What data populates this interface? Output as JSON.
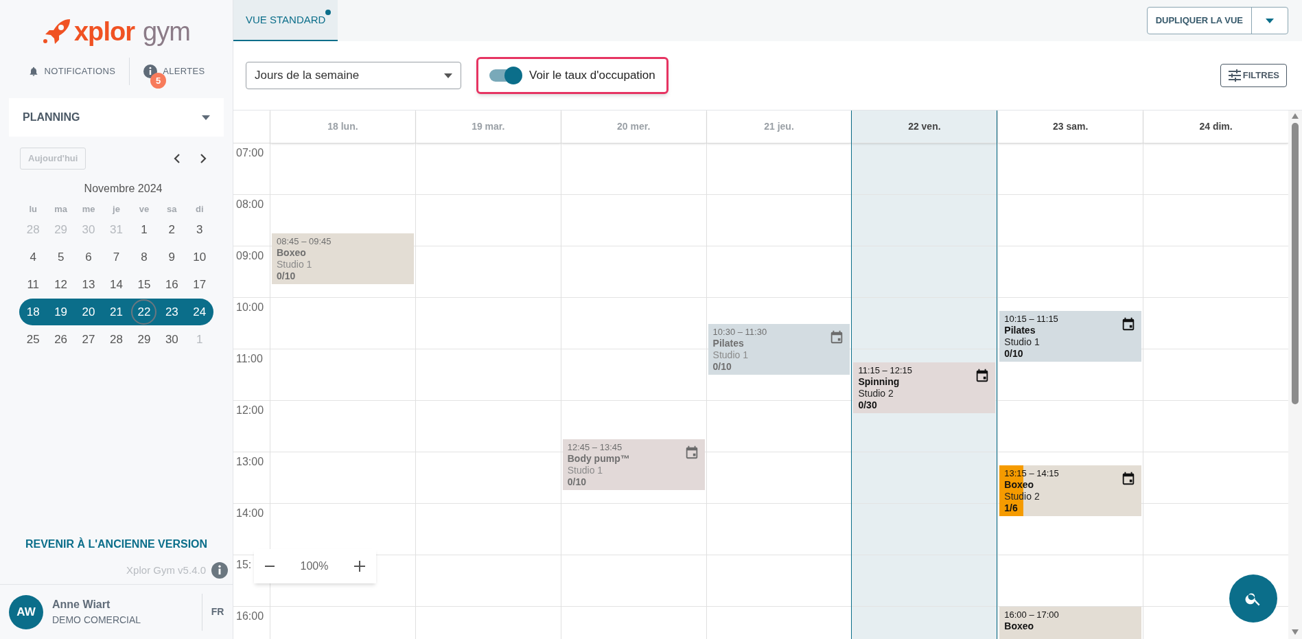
{
  "logo": {
    "brand": "xplor",
    "product": "gym"
  },
  "header_links": [
    {
      "kind": "notifications",
      "label": "NOTIFICATIONS"
    },
    {
      "kind": "alerts",
      "label": "ALERTES",
      "badge": "5"
    }
  ],
  "section_select": {
    "value": "PLANNING"
  },
  "mini_calendar": {
    "today_button": "Aujourd'hui",
    "month": "Novembre 2024",
    "weekdays": [
      "lu",
      "ma",
      "me",
      "je",
      "ve",
      "sa",
      "di"
    ],
    "weeks": [
      [
        {
          "day": "28",
          "muted": true,
          "in_week": false,
          "today": false
        },
        {
          "day": "29",
          "muted": true,
          "in_week": false,
          "today": false
        },
        {
          "day": "30",
          "muted": true,
          "in_week": false,
          "today": false
        },
        {
          "day": "31",
          "muted": true,
          "in_week": false,
          "today": false
        },
        {
          "day": "1",
          "muted": false,
          "in_week": false,
          "today": false
        },
        {
          "day": "2",
          "muted": false,
          "in_week": false,
          "today": false
        },
        {
          "day": "3",
          "muted": false,
          "in_week": false,
          "today": false
        }
      ],
      [
        {
          "day": "4",
          "muted": false,
          "in_week": false,
          "today": false
        },
        {
          "day": "5",
          "muted": false,
          "in_week": false,
          "today": false
        },
        {
          "day": "6",
          "muted": false,
          "in_week": false,
          "today": false
        },
        {
          "day": "7",
          "muted": false,
          "in_week": false,
          "today": false
        },
        {
          "day": "8",
          "muted": false,
          "in_week": false,
          "today": false
        },
        {
          "day": "9",
          "muted": false,
          "in_week": false,
          "today": false
        },
        {
          "day": "10",
          "muted": false,
          "in_week": false,
          "today": false
        }
      ],
      [
        {
          "day": "11",
          "muted": false,
          "in_week": false,
          "today": false
        },
        {
          "day": "12",
          "muted": false,
          "in_week": false,
          "today": false
        },
        {
          "day": "13",
          "muted": false,
          "in_week": false,
          "today": false
        },
        {
          "day": "14",
          "muted": false,
          "in_week": false,
          "today": false
        },
        {
          "day": "15",
          "muted": false,
          "in_week": false,
          "today": false
        },
        {
          "day": "16",
          "muted": false,
          "in_week": false,
          "today": false
        },
        {
          "day": "17",
          "muted": false,
          "in_week": false,
          "today": false
        }
      ],
      [
        {
          "day": "18",
          "in_week": true,
          "today": false
        },
        {
          "day": "19",
          "in_week": true,
          "today": false
        },
        {
          "day": "20",
          "in_week": true,
          "today": false
        },
        {
          "day": "21",
          "in_week": true,
          "today": false
        },
        {
          "day": "22",
          "in_week": true,
          "today": true
        },
        {
          "day": "23",
          "in_week": true,
          "today": false
        },
        {
          "day": "24",
          "in_week": true,
          "today": false
        }
      ],
      [
        {
          "day": "25",
          "muted": false,
          "in_week": false,
          "today": false
        },
        {
          "day": "26",
          "muted": false,
          "in_week": false,
          "today": false
        },
        {
          "day": "27",
          "muted": false,
          "in_week": false,
          "today": false
        },
        {
          "day": "28",
          "muted": false,
          "in_week": false,
          "today": false
        },
        {
          "day": "29",
          "muted": false,
          "in_week": false,
          "today": false
        },
        {
          "day": "30",
          "muted": false,
          "in_week": false,
          "today": false
        },
        {
          "day": "1",
          "muted": true,
          "in_week": false,
          "today": false
        }
      ]
    ]
  },
  "revert_link": "REVENIR À L'ANCIENNE VERSION",
  "version": "Xplor Gym v5.4.0",
  "user": {
    "initials": "AW",
    "name": "Anne Wiart",
    "org": "DEMO COMERCIAL"
  },
  "language": "FR",
  "tabs": [
    {
      "label": "VUE STANDARD",
      "selected": true,
      "modified": true
    }
  ],
  "duplicate_button": "DUPLIQUER LA VUE",
  "view_select": {
    "value": "Jours de la semaine"
  },
  "occupancy_toggle": {
    "label": "Voir le taux d'occupation",
    "on": true,
    "highlighted": true
  },
  "filters_button": "FILTRES",
  "hours": [
    "07:00",
    "08:00",
    "09:00",
    "10:00",
    "11:00",
    "12:00",
    "13:00",
    "14:00",
    "15:",
    "16:00"
  ],
  "zoom": {
    "value": "100%"
  },
  "days": [
    {
      "label": "18 lun.",
      "past": true,
      "selected": false,
      "events": [
        {
          "time": "08:45 – 09:45",
          "title": "Boxeo",
          "room": "Studio 1",
          "count": "0/10",
          "color": "#e3ddd4",
          "icon": false
        }
      ]
    },
    {
      "label": "19 mar.",
      "past": true,
      "selected": false
    },
    {
      "label": "20 mer.",
      "past": true,
      "selected": false,
      "events": [
        {
          "time": "12:45 – 13:45",
          "title": "Body pump™",
          "room": "Studio 1",
          "count": "0/10",
          "color": "#e2d9d8",
          "icon": true
        }
      ]
    },
    {
      "label": "21 jeu.",
      "past": true,
      "selected": false,
      "events": [
        {
          "time": "10:30 – 11:30",
          "title": "Pilates",
          "room": "Studio 1",
          "count": "0/10",
          "color": "#d3dce1",
          "icon": true
        }
      ]
    },
    {
      "label": "22 ven.",
      "past": false,
      "selected": true,
      "events": [
        {
          "time": "11:15 – 12:15",
          "title": "Spinning",
          "room": "Studio 2",
          "count": "0/30",
          "color": "#e2d9d8",
          "icon": true
        }
      ]
    },
    {
      "label": "23 sam.",
      "past": false,
      "selected": false,
      "events": [
        {
          "time": "10:15 – 11:15",
          "title": "Pilates",
          "room": "Studio 1",
          "count": "0/10",
          "color": "#d3dce1",
          "icon": true
        },
        {
          "time": "13:15 – 14:15",
          "title": "Boxeo",
          "room": "Studio 2",
          "count": "1/6",
          "color": "#e3ddd4",
          "icon": true,
          "level": 0.167
        },
        {
          "time": "16:00 – 17:00",
          "title": "Boxeo",
          "color": "#e3ddd4",
          "icon": false
        }
      ]
    },
    {
      "label": "24 dim.",
      "past": false,
      "selected": false
    }
  ]
}
